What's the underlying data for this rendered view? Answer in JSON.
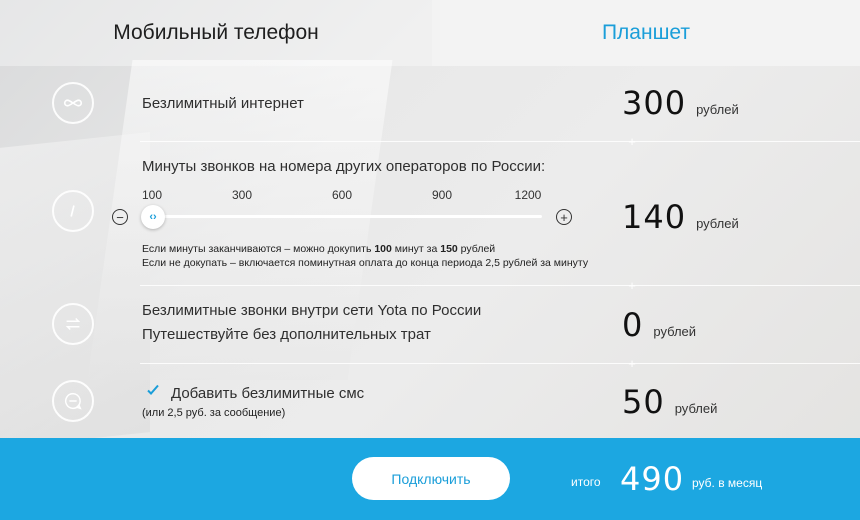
{
  "tabs": {
    "mobile": "Мобильный телефон",
    "tablet": "Планшет"
  },
  "rows": {
    "internet": {
      "label": "Безлимитный интернет",
      "price": "300",
      "unit": "рублей"
    },
    "minutes": {
      "label": "Минуты звонков на номера других операторов по России:",
      "price": "140",
      "unit": "рублей",
      "ticks": [
        "100",
        "300",
        "600",
        "900",
        "1200"
      ],
      "selected": "100",
      "note1_prefix": "Если минуты заканчиваются – можно докупить ",
      "note1_bold1": "100",
      "note1_mid": " минут за ",
      "note1_bold2": "150",
      "note1_suffix": " рублей",
      "note2": "Если не докупать – включается поминутная оплата до конца периода 2,5 рублей за минуту"
    },
    "yota": {
      "line1": "Безлимитные звонки внутри сети Yota по России",
      "line2": "Путешествуйте без дополнительных трат",
      "price": "0",
      "unit": "рублей"
    },
    "sms": {
      "label": "Добавить безлимитные смс",
      "sublabel": "(или 2,5 руб. за сообщение)",
      "price": "50",
      "unit": "рублей"
    }
  },
  "footer": {
    "connect": "Подключить",
    "total_label": "итого",
    "total": "490",
    "total_unit": "руб. в месяц"
  },
  "colors": {
    "accent": "#1ca7e1",
    "text": "#2b2b2b"
  },
  "icons": [
    "infinity-icon",
    "clock-icon",
    "arrows-icon",
    "chat-icon",
    "check-icon",
    "minus-icon",
    "plus-icon"
  ]
}
